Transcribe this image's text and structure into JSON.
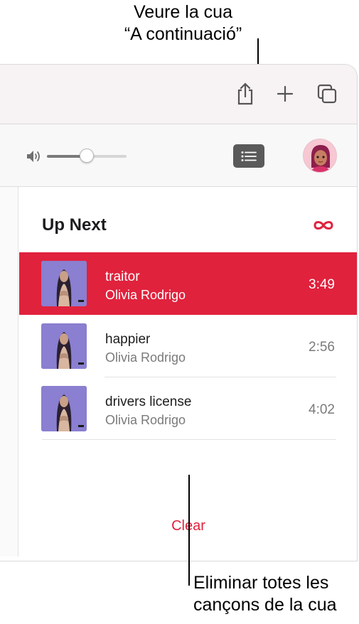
{
  "annotations": {
    "top_line1": "Veure la cua",
    "top_line2": "“A continuació”",
    "bottom_line1": "Eliminar totes les",
    "bottom_line2": "cançons de la cua"
  },
  "toolbar": {
    "icons": [
      "share-icon",
      "plus-icon",
      "tabs-icon"
    ]
  },
  "player": {
    "volume_level": 0.5,
    "queue_button_icon": "list-icon",
    "avatar_icon": "memoji-avatar"
  },
  "up_next": {
    "title": "Up Next",
    "autoplay_icon": "infinity-icon",
    "songs": [
      {
        "title": "traitor",
        "artist": "Olivia Rodrigo",
        "duration": "3:49",
        "active": true
      },
      {
        "title": "happier",
        "artist": "Olivia Rodrigo",
        "duration": "2:56",
        "active": false
      },
      {
        "title": "drivers license",
        "artist": "Olivia Rodrigo",
        "duration": "4:02",
        "active": false
      }
    ],
    "clear_label": "Clear"
  },
  "colors": {
    "accent": "#e0223d",
    "queue_button": "#5a5a5a",
    "album_art": "#8a7fd0"
  }
}
